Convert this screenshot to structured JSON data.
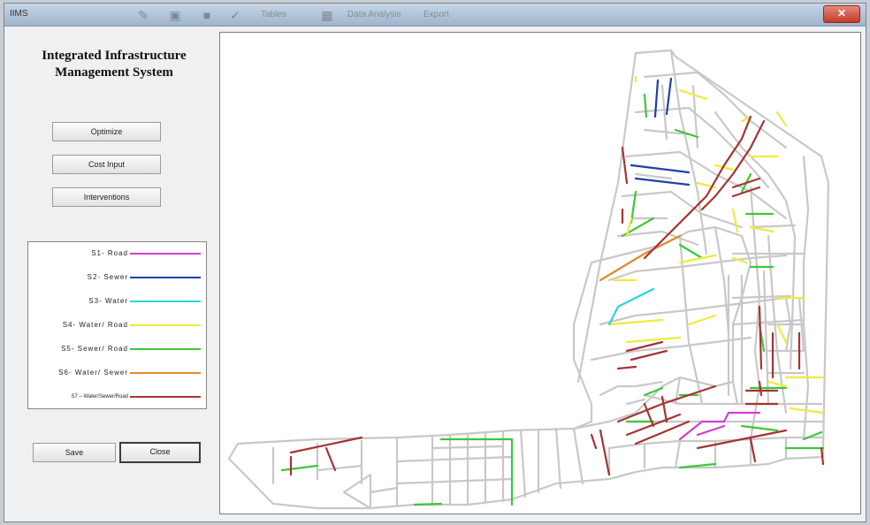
{
  "window": {
    "title": "IIMS"
  },
  "toolbar": {
    "icons": [
      "brush-icon",
      "save-icon",
      "briefcase-icon",
      "check-icon",
      "grid-icon"
    ],
    "labels": [
      "Tables",
      "Data Analysis",
      "Export"
    ]
  },
  "panel": {
    "heading": "Integrated Infrastructure Management System",
    "buttons": {
      "optimize": "Optimize",
      "cost_input": "Cost Input",
      "interventions": "Interventions",
      "save": "Save",
      "close": "Close"
    }
  },
  "legend": [
    {
      "label": "S1- Road",
      "color": "#d63bd6",
      "small": false
    },
    {
      "label": "S2- Sewer",
      "color": "#1d3fb0",
      "small": false
    },
    {
      "label": "S3- Water",
      "color": "#2bd6d6",
      "small": false
    },
    {
      "label": "S4- Water/ Road",
      "color": "#f0ea3c",
      "small": false
    },
    {
      "label": "S5- Sewer/ Road",
      "color": "#3ac83a",
      "small": false
    },
    {
      "label": "S6- Water/ Sewer",
      "color": "#e08a2a",
      "small": false
    },
    {
      "label": "S7 – Water/Sewer/Road",
      "color": "#a83232",
      "small": true
    }
  ],
  "colors": {
    "base_network": "#c8c8c8",
    "window_frame": "#7a8696"
  }
}
